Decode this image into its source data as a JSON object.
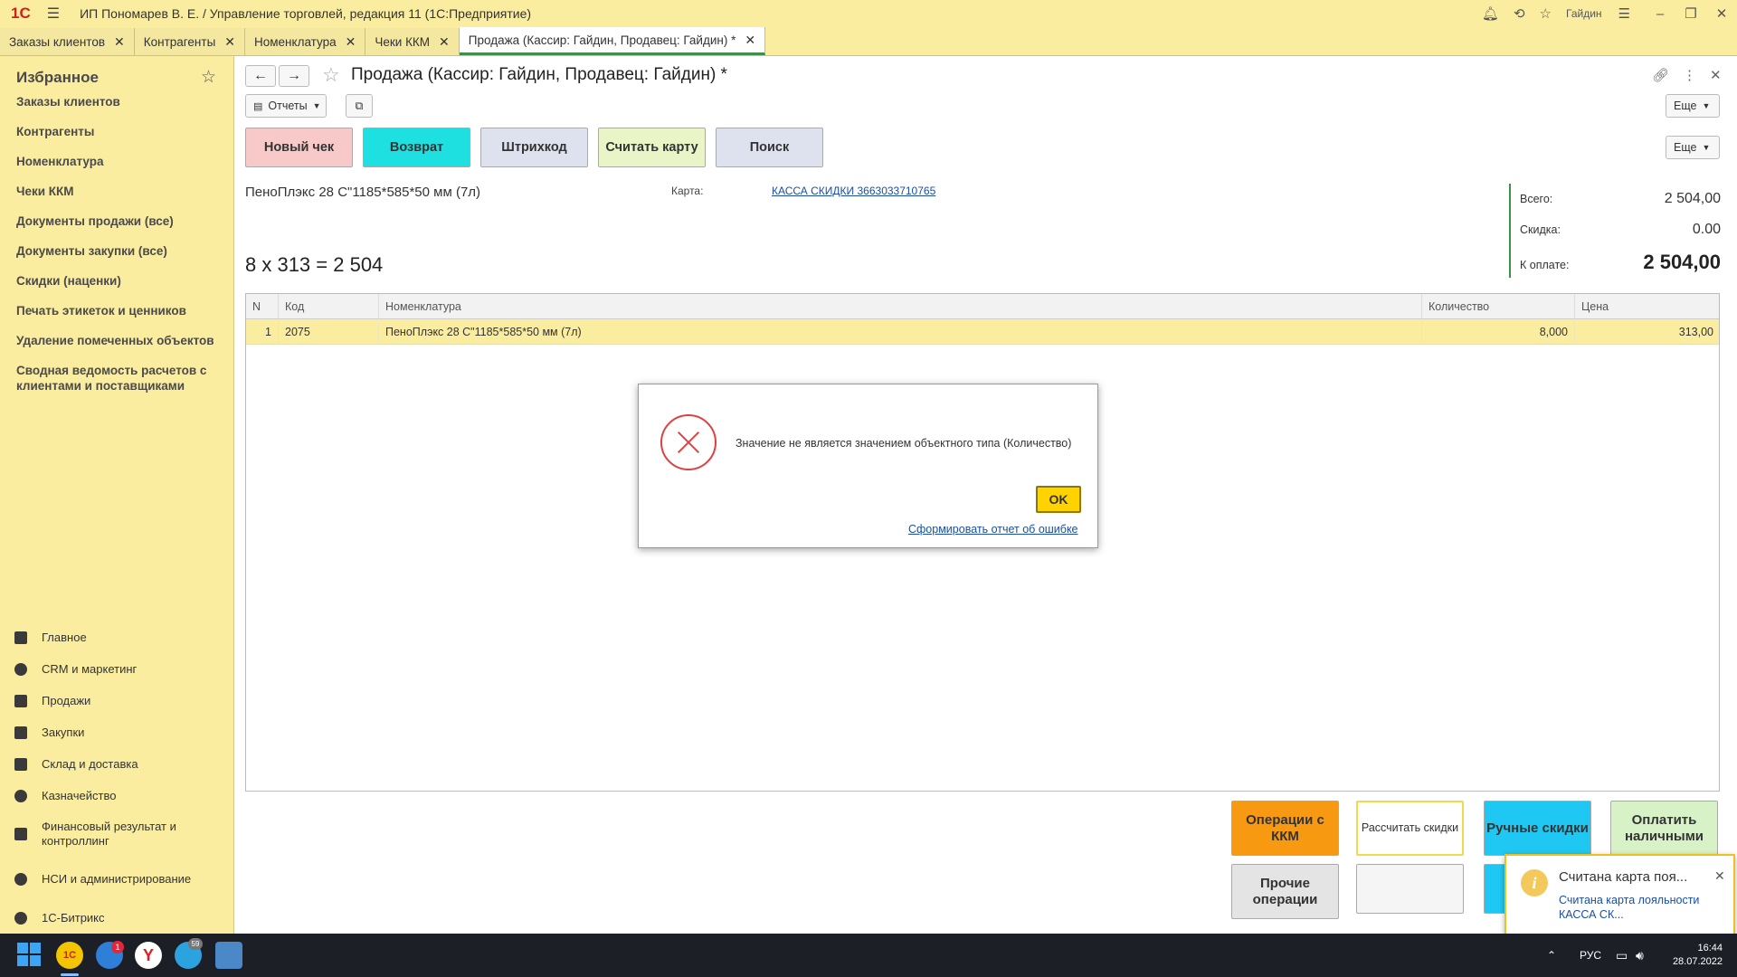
{
  "titlebar": {
    "logo": "1С",
    "title": "ИП Пономарев В. Е. / Управление торговлей, редакция 11  (1С:Предприятие)",
    "user": "Гайдин",
    "icons": [
      "bell-icon",
      "history-icon",
      "star-icon",
      "settings-icon",
      "minimize-icon",
      "restore-icon",
      "close-icon"
    ]
  },
  "tabs": [
    {
      "label": "Заказы клиентов"
    },
    {
      "label": "Контрагенты"
    },
    {
      "label": "Номенклатура"
    },
    {
      "label": "Чеки ККМ"
    },
    {
      "label": "Продажа (Кассир: Гайдин, Продавец: Гайдин) *",
      "active": true
    }
  ],
  "sidebar": {
    "favorites_title": "Избранное",
    "favorites": [
      "Заказы клиентов",
      "Контрагенты",
      "Номенклатура",
      "Чеки ККМ",
      "Документы продажи (все)",
      "Документы закупки (все)",
      "Скидки (наценки)",
      "Печать этикеток и ценников",
      "Удаление помеченных объектов",
      "Сводная ведомость расчетов с клиентами и поставщиками"
    ],
    "sections": [
      "Главное",
      "CRM и маркетинг",
      "Продажи",
      "Закупки",
      "Склад и доставка",
      "Казначейство",
      "Финансовый результат и контроллинг",
      "НСИ и администрирование",
      "1С-Битрикс"
    ]
  },
  "form": {
    "title": "Продажа (Кассир: Гайдин, Продавец: Гайдин) *",
    "reports_label": "Отчеты",
    "more_label": "Еще",
    "buttons": {
      "new_check": "Новый чек",
      "return": "Возврат",
      "barcode": "Штрихкод",
      "read_card": "Считать карту",
      "search": "Поиск"
    },
    "current_item": "ПеноПлэкс 28 С\"1185*585*50 мм (7л)",
    "card_label": "Карта:",
    "card_value": "КАССА СКИДКИ 3663033710765",
    "calc_line": "8 x 313 = 2 504",
    "totals": {
      "total_label": "Всего:",
      "total_value": "2 504,00",
      "discount_label": "Скидка:",
      "discount_value": "0.00",
      "to_pay_label": "К оплате:",
      "to_pay_value": "2 504,00"
    },
    "table": {
      "headers": [
        "N",
        "Код",
        "Номенклатура",
        "Количество",
        "Цена"
      ],
      "rows": [
        {
          "n": "1",
          "code": "2075",
          "name": "ПеноПлэкс 28 С\"1185*585*50 мм (7л)",
          "qty": "8,000",
          "price": "313,00"
        }
      ]
    },
    "bottom_buttons": {
      "kkm_ops": "Операции с ККМ",
      "calc_discounts": "Рассчитать скидки",
      "manual_discounts": "Ручные скидки",
      "pay_cash": "Оплатить наличными",
      "other_ops": "Прочие операции"
    }
  },
  "dialog": {
    "message": "Значение не является значением объектного типа (Количество)",
    "ok_label": "OK",
    "report_link": "Сформировать отчет об ошибке"
  },
  "notification": {
    "title": "Считана карта поя...",
    "text": "Считана карта лояльности КАССА СК..."
  },
  "taskbar": {
    "badges": {
      "mail": "1",
      "telegram": "59"
    },
    "lang": "РУС",
    "time": "16:44",
    "date": "28.07.2022"
  }
}
